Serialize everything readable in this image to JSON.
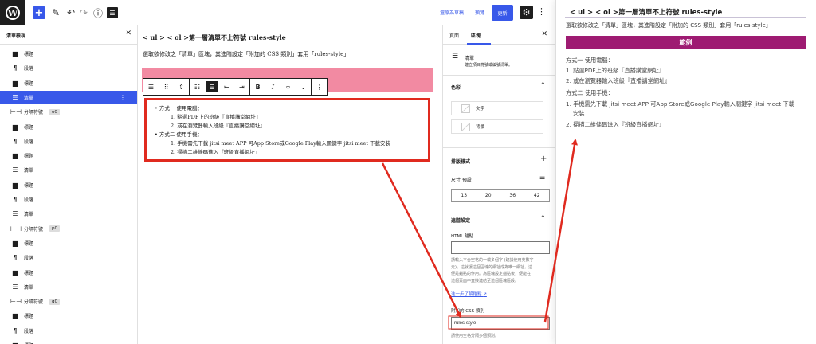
{
  "topbar": {
    "wp_logo": "W",
    "save_draft": "還原為草稿",
    "preview": "預覽",
    "update": "更新"
  },
  "list_view": {
    "title": "清單檢視",
    "items": [
      {
        "icon": "heading-icon",
        "glyph": "▆",
        "label": "標題"
      },
      {
        "icon": "paragraph-icon",
        "glyph": "¶",
        "label": "段落"
      },
      {
        "icon": "heading-icon",
        "glyph": "▆",
        "label": "標題"
      },
      {
        "icon": "list-icon",
        "glyph": "☰",
        "label": "清單",
        "active": true
      },
      {
        "icon": "separator-icon",
        "glyph": "⊢⊣",
        "label": "分隔符號",
        "badge": "o0"
      },
      {
        "icon": "heading-icon",
        "glyph": "▆",
        "label": "標題"
      },
      {
        "icon": "paragraph-icon",
        "glyph": "¶",
        "label": "段落"
      },
      {
        "icon": "heading-icon",
        "glyph": "▆",
        "label": "標題"
      },
      {
        "icon": "list-icon",
        "glyph": "☰",
        "label": "清單"
      },
      {
        "icon": "heading-icon",
        "glyph": "▆",
        "label": "標題"
      },
      {
        "icon": "paragraph-icon",
        "glyph": "¶",
        "label": "段落"
      },
      {
        "icon": "list-icon",
        "glyph": "☰",
        "label": "清單"
      },
      {
        "icon": "separator-icon",
        "glyph": "⊢⊣",
        "label": "分隔符號",
        "badge": "p0"
      },
      {
        "icon": "heading-icon",
        "glyph": "▆",
        "label": "標題"
      },
      {
        "icon": "paragraph-icon",
        "glyph": "¶",
        "label": "段落"
      },
      {
        "icon": "heading-icon",
        "glyph": "▆",
        "label": "標題"
      },
      {
        "icon": "list-icon",
        "glyph": "☰",
        "label": "清單"
      },
      {
        "icon": "separator-icon",
        "glyph": "⊢⊣",
        "label": "分隔符號",
        "badge": "q0"
      },
      {
        "icon": "heading-icon",
        "glyph": "▆",
        "label": "標題"
      },
      {
        "icon": "paragraph-icon",
        "glyph": "¶",
        "label": "段落"
      },
      {
        "icon": "heading-icon",
        "glyph": "▆",
        "label": "標題"
      }
    ]
  },
  "canvas": {
    "heading_prefix": "< ",
    "heading_ul": "ul",
    "heading_mid": " > < ",
    "heading_ol": "ol",
    "heading_rest": " >第一層清單不上符號 rules-style",
    "paragraph": "選取欲修改之「清單」區塊，其進階設定「附加的 CSS 類別」套用「rules-style」",
    "list": [
      "• 方式一 使用電腦：",
      "1. 點選PDF上的班級『直播講堂網址』",
      "2. 或在瀏覽器輸入班級『直播講堂網址』",
      "• 方式二 使用手機：",
      "1. 手機需先下載 jitsi meet APP 可App Store或Google Play輸入關鍵字 jitsi meet 下載安裝",
      "2. 掃描二維條碼進入『班級直播網址』"
    ]
  },
  "sidebar": {
    "tab_page": "頁面",
    "tab_block": "區塊",
    "block_name": "清單",
    "block_desc": "建立項目符號或編號清單。",
    "color_title": "色彩",
    "color_text": "文字",
    "color_background": "背景",
    "typography_title": "排版樣式",
    "size_label": "尺寸 預設",
    "sizes": [
      "13",
      "20",
      "36",
      "42"
    ],
    "advanced_title": "進階設定",
    "html_anchor_label": "HTML 錨點",
    "html_anchor_value": "",
    "anchor_help": [
      "請輸入不含空格的一或多個字 (建議使用英數字",
      "元)，這就讓這個區塊的網址成為唯一網址，這",
      "便是錨點的作用。為區塊設定錨點後，便能在",
      "這個頁面中直接連結至這個區塊區段。"
    ],
    "learn_more": "進一步了解錨點",
    "css_class_label": "附加的 CSS 類別",
    "css_class_value": "rules-style",
    "css_class_help": "請使用空格分隔多個類別。"
  },
  "preview": {
    "title": "< ul > < ol >第一層清單不上符號 rules-style",
    "desc": "選取欲修改之「清單」區塊，其進階設定「附加的 CSS 類別」套用「rules-style」",
    "example_label": "範例",
    "lines": [
      "方式一 使用電腦：",
      "1. 點選PDF上的班級『直播講堂網址』",
      "2. 或在瀏覽器輸入班級『直播講堂網址』",
      "方式二 使用手機：",
      "1. 手機需先下載 jitsi meet APP 可App Store或Google Play輸入關鍵字 jitsi meet 下載",
      "安裝",
      "2. 掃描二維條碼進入『班級直播網址』"
    ]
  },
  "colors": {
    "accent": "#3858e9",
    "highlight_border": "#e02a1f",
    "pink_block": "#f28aa2",
    "example_bar": "#9e1b72"
  }
}
